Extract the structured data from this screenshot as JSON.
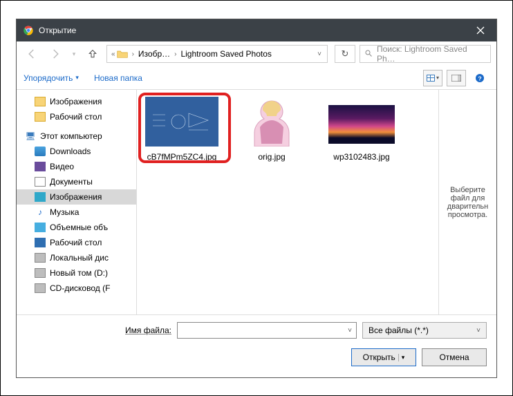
{
  "titlebar": {
    "title": "Открытие"
  },
  "nav": {
    "crumb1": "Изобр…",
    "crumb2": "Lightroom Saved Photos",
    "search_placeholder": "Поиск: Lightroom Saved Ph…"
  },
  "toolbar": {
    "organize": "Упорядочить",
    "newfolder": "Новая папка"
  },
  "sidebar": {
    "images": "Изображения",
    "desktop": "Рабочий стол",
    "thispc": "Этот компьютер",
    "downloads": "Downloads",
    "video": "Видео",
    "documents": "Документы",
    "images2": "Изображения",
    "music": "Музыка",
    "objects": "Объемные объ",
    "desktop2": "Рабочий стол",
    "localdisk": "Локальный дис",
    "newvol": "Новый том (D:)",
    "cddrive": "CD-дисковод (F"
  },
  "files": {
    "f1": "cB7fMPm5ZC4.jpg",
    "f2": "orig.jpg",
    "f3": "wp3102483.jpg"
  },
  "preview": {
    "text": "Выберите файл для дварительн просмотра."
  },
  "bottom": {
    "fname_label": "Имя файла:",
    "filter": "Все файлы (*.*)",
    "open": "Открыть",
    "cancel": "Отмена"
  }
}
